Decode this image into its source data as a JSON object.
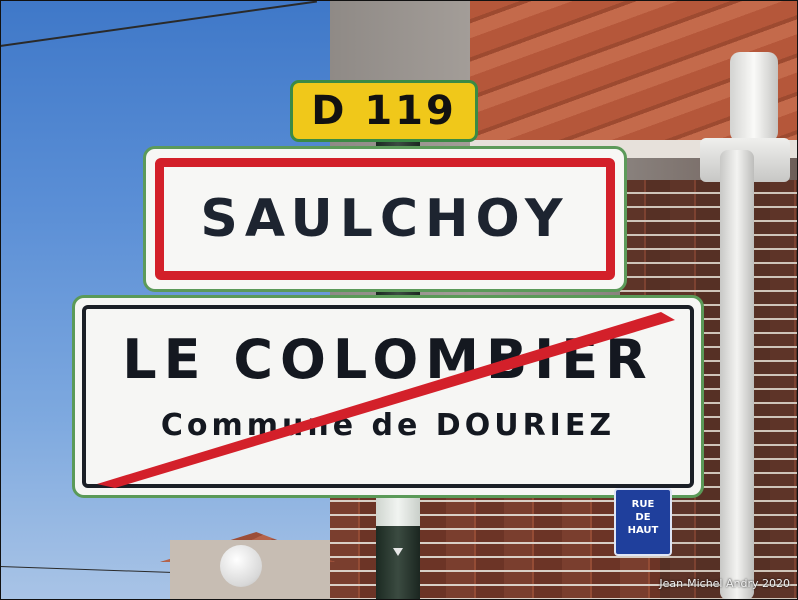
{
  "route_sign": {
    "text": "D 119"
  },
  "town_sign": {
    "text": "SAULCHOY"
  },
  "exit_sign": {
    "title": "LE COLOMBIER",
    "subtitle": "Commune de DOURIEZ"
  },
  "street_plate": {
    "line1": "RUE",
    "line2": "DE",
    "line3": "HAUT"
  },
  "credit": "Jean-Michel Andry 2020",
  "colors": {
    "sign_red": "#d3202a",
    "sign_border_green": "#5c9a5a",
    "route_yellow": "#f0c81a",
    "plate_blue": "#1f3f9c"
  }
}
